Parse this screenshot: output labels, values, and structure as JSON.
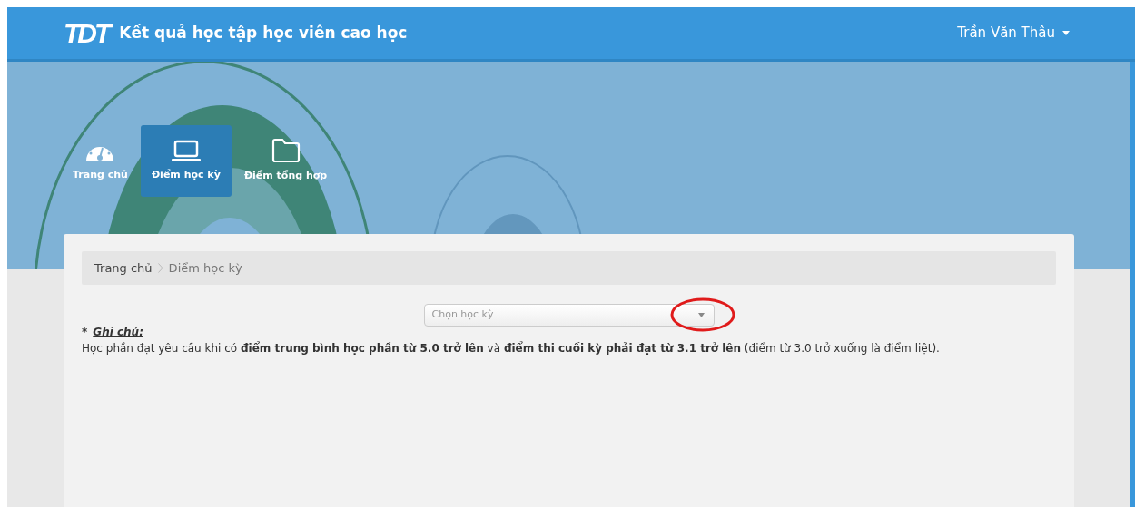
{
  "header": {
    "logo": "TDT",
    "title": "Kết quả học tập học viên cao học",
    "user": "Trần Văn Thâu"
  },
  "nav": [
    {
      "label": "Trang chủ",
      "kind": "dashboard",
      "selected": false
    },
    {
      "label": "Điểm học kỳ",
      "kind": "laptop",
      "selected": true
    },
    {
      "label": "Điểm tổng hợp",
      "kind": "folder",
      "selected": false
    }
  ],
  "breadcrumb": [
    "Trang chủ",
    "Điểm học kỳ"
  ],
  "semester_select": {
    "placeholder": "Chọn học kỳ",
    "highlighted": true
  },
  "note": {
    "heading": "Ghi chú:",
    "marker": "*",
    "text": "Học phần đạt yêu cầu khi có **điểm trung bình học phần từ 5.0 trở lên** và **điểm thi cuối kỳ phải đạt từ 3.1 trở lên** (điểm từ 3.0 trở xuống là điểm liệt)."
  }
}
